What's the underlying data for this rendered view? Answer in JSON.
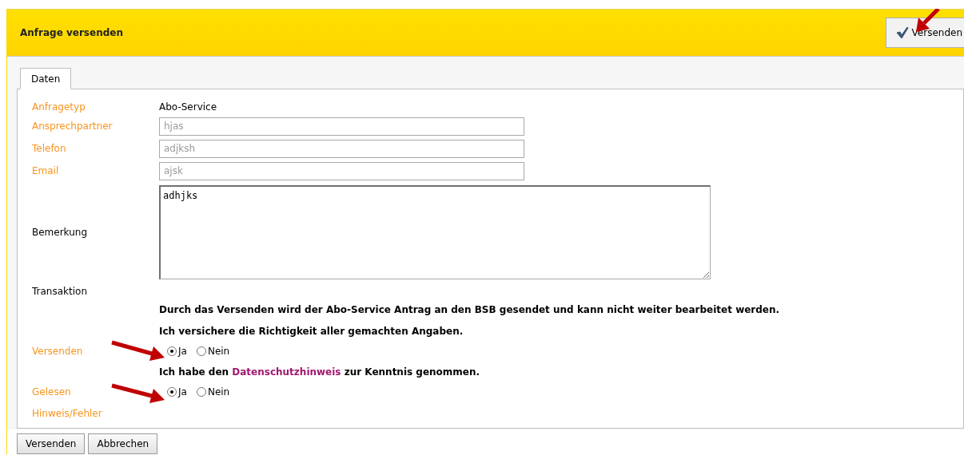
{
  "header": {
    "title": "Anfrage versenden",
    "action_button": "Versenden"
  },
  "tabs": [
    {
      "label": "Daten",
      "selected": true
    }
  ],
  "form": {
    "rows": [
      {
        "kind": "text",
        "label": "Anfragetyp",
        "accent": true,
        "value": "Abo-Service"
      },
      {
        "kind": "input",
        "label": "Ansprechpartner",
        "accent": true,
        "value": "hjas",
        "disabled": true
      },
      {
        "kind": "input",
        "label": "Telefon",
        "accent": true,
        "value": "adjksh",
        "disabled": true
      },
      {
        "kind": "input",
        "label": "Email",
        "accent": true,
        "value": "ajsk",
        "disabled": true
      },
      {
        "kind": "textarea",
        "label": "Bemerkung",
        "accent": false,
        "value": "adhjks"
      },
      {
        "kind": "label",
        "label": "Transaktion",
        "accent": false
      },
      {
        "kind": "note",
        "text": "Durch das Versenden wird der Abo-Service Antrag an den BSB gesendet und kann nicht weiter bearbeitet werden."
      },
      {
        "kind": "note",
        "text": "Ich versichere die Richtigkeit aller gemachten Angaben."
      },
      {
        "kind": "radio",
        "label": "Versenden",
        "accent": true,
        "options": [
          {
            "label": "Ja",
            "selected": true
          },
          {
            "label": "Nein",
            "selected": false
          }
        ]
      },
      {
        "kind": "note",
        "text": "Ich habe den ",
        "link": "Datenschutzhinweis",
        "text_after": " zur Kenntnis genommen."
      },
      {
        "kind": "radio",
        "label": "Gelesen",
        "accent": true,
        "options": [
          {
            "label": "Ja",
            "selected": true
          },
          {
            "label": "Nein",
            "selected": false
          }
        ]
      },
      {
        "kind": "label",
        "label": "Hinweis/Fehler",
        "accent": true
      }
    ]
  },
  "buttons": [
    "Versenden",
    "Abbrechen"
  ]
}
